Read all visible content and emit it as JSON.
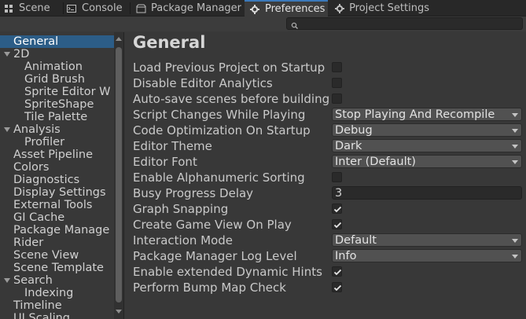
{
  "tabs": [
    {
      "label": "Scene",
      "icon": "grid-icon",
      "active": false
    },
    {
      "label": "Console",
      "icon": "console-icon",
      "active": false
    },
    {
      "label": "Package Manager",
      "icon": "package-icon",
      "active": false
    },
    {
      "label": "Preferences",
      "icon": "gear-icon",
      "active": true
    },
    {
      "label": "Project Settings",
      "icon": "gear-icon",
      "active": false
    }
  ],
  "search": {
    "placeholder": ""
  },
  "sidebar": {
    "items": [
      {
        "label": "General",
        "level": 0,
        "expandable": false,
        "selected": true
      },
      {
        "label": "2D",
        "level": 0,
        "expandable": true
      },
      {
        "label": "Animation",
        "level": 1
      },
      {
        "label": "Grid Brush",
        "level": 1
      },
      {
        "label": "Sprite Editor W",
        "level": 1
      },
      {
        "label": "SpriteShape",
        "level": 1
      },
      {
        "label": "Tile Palette",
        "level": 1
      },
      {
        "label": "Analysis",
        "level": 0,
        "expandable": true
      },
      {
        "label": "Profiler",
        "level": 1
      },
      {
        "label": "Asset Pipeline",
        "level": 0
      },
      {
        "label": "Colors",
        "level": 0
      },
      {
        "label": "Diagnostics",
        "level": 0
      },
      {
        "label": "Display Settings",
        "level": 0
      },
      {
        "label": "External Tools",
        "level": 0
      },
      {
        "label": "GI Cache",
        "level": 0
      },
      {
        "label": "Package Manage",
        "level": 0
      },
      {
        "label": "Rider",
        "level": 0
      },
      {
        "label": "Scene View",
        "level": 0
      },
      {
        "label": "Scene Template",
        "level": 0
      },
      {
        "label": "Search",
        "level": 0,
        "expandable": true
      },
      {
        "label": "Indexing",
        "level": 1
      },
      {
        "label": "Timeline",
        "level": 0
      },
      {
        "label": "UI Scaling",
        "level": 0
      }
    ]
  },
  "content": {
    "title": "General",
    "settings": [
      {
        "label": "Load Previous Project on Startup",
        "type": "checkbox",
        "checked": false
      },
      {
        "label": "Disable Editor Analytics",
        "type": "checkbox",
        "checked": false
      },
      {
        "label": "Auto-save scenes before building",
        "type": "checkbox",
        "checked": false
      },
      {
        "label": "Script Changes While Playing",
        "type": "dropdown",
        "value": "Stop Playing And Recompile"
      },
      {
        "label": "Code Optimization On Startup",
        "type": "dropdown",
        "value": "Debug"
      },
      {
        "label": "Editor Theme",
        "type": "dropdown",
        "value": "Dark"
      },
      {
        "label": "Editor Font",
        "type": "dropdown",
        "value": "Inter (Default)"
      },
      {
        "label": "Enable Alphanumeric Sorting",
        "type": "checkbox",
        "checked": false
      },
      {
        "label": "Busy Progress Delay",
        "type": "text",
        "value": "3"
      },
      {
        "label": "Graph Snapping",
        "type": "checkbox",
        "checked": true
      },
      {
        "label": "Create Game View On Play",
        "type": "checkbox",
        "checked": true
      },
      {
        "label": "Interaction Mode",
        "type": "dropdown",
        "value": "Default"
      },
      {
        "label": "Package Manager Log Level",
        "type": "dropdown",
        "value": "Info"
      },
      {
        "label": "Enable extended Dynamic Hints",
        "type": "checkbox",
        "checked": true
      },
      {
        "label": "Perform Bump Map Check",
        "type": "checkbox",
        "checked": true
      }
    ]
  },
  "colors": {
    "accent": "#3a79bb",
    "selection": "#2c5d87",
    "background": "#383838"
  }
}
